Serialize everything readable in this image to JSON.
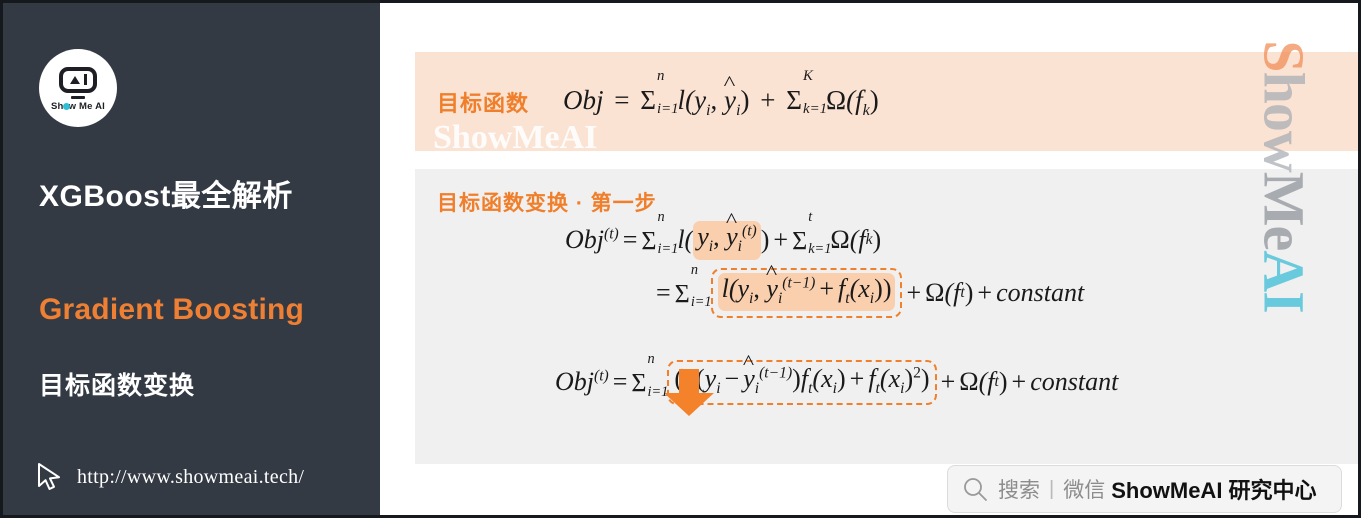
{
  "sidebar": {
    "logo": {
      "icon": "showmeai-robot-logo",
      "text_pre": "Sh",
      "text_dot": "o",
      "text_post": "w Me AI"
    },
    "title": "XGBoost最全解析",
    "subtitle_en": "Gradient Boosting",
    "subtitle_cn": "目标函数变换",
    "url": "http://www.showmeai.tech/",
    "cursor_icon": "cursor-arrow-icon",
    "background_color": "#333a44",
    "accent_color": "#ef8033"
  },
  "watermark": {
    "vertical": {
      "part_s": "S",
      "part_how": "how",
      "part_me": "Me",
      "part_ai": "AI",
      "color_s": "#f08b52",
      "color_how": "#a7adb3",
      "color_me": "#8d9298",
      "color_ai": "#37bcd6"
    },
    "inline": "ShowMeAI"
  },
  "top_band": {
    "label": "目标函数",
    "background_color": "#fbe3d4",
    "equation": {
      "lhs": "Obj",
      "eq": "=",
      "sum1": {
        "symbol": "Σ",
        "lower": "i=1",
        "upper": "n"
      },
      "loss": "l(y",
      "term_yi_sub": "i",
      "comma": ", ",
      "yhat": "y",
      "yhat_sub": "i",
      "close": ")",
      "plus": "+",
      "sum2": {
        "symbol": "Σ",
        "lower": "k=1",
        "upper": "K"
      },
      "omega": "Ω(f",
      "omega_sub": "k",
      "omega_close": ")"
    },
    "equation_text": "Obj = Σ_{i=1}^{n} l(y_i, ŷ_i) + Σ_{k=1}^{K} Ω(f_k)"
  },
  "body_panel": {
    "label": "目标函数变换 · 第一步",
    "background_color": "#f0f0f0",
    "arrow_icon": "arrow-down-icon",
    "arrow_color": "#f4822b",
    "highlight_color": "#f9cfae",
    "dash_border_color": "#f0802c",
    "equations": [
      {
        "id": "line-1",
        "text": "Obj^{(t)} = Σ_{i=1}^{n} l(y_i, ŷ_i^{(t)}) + Σ_{k=1}^{t} Ω(f_k)",
        "lhs": "Obj",
        "lhs_sup": "(t)",
        "eq": "=",
        "sum": {
          "symbol": "Σ",
          "lower": "i=1",
          "upper": "n"
        },
        "highlighted": "y_i, ŷ_i^{(t)}",
        "tail": "+ Σ_{k=1}^{t} Ω(f_k)"
      },
      {
        "id": "line-2",
        "text": "= Σ_{i=1}^{n} l(y_i, ŷ_i^{(t-1)} + f_t(x_i)) + Ω(f_t) + constant",
        "eq": "=",
        "sum": {
          "symbol": "Σ",
          "lower": "i=1",
          "upper": "n"
        },
        "boxed": "l(y_i, ŷ_i^{(t-1)} + f_t(x_i))",
        "tail": "+ Ω(f_t) + constant"
      },
      {
        "id": "line-3",
        "text": "Obj^{(t)} = Σ_{i=1}^{n} (2(y_i - ŷ_i^{(t-1)}) f_t(x_i) + f_t(x_i)^2) + Ω(f_t) + constant",
        "lhs": "Obj",
        "lhs_sup": "(t)",
        "eq": "=",
        "sum": {
          "symbol": "Σ",
          "lower": "i=1",
          "upper": "n"
        },
        "boxed": "(2(y_i - ŷ_i^{(t-1)}) f_t(x_i) + f_t(x_i)^2)",
        "tail": "+ Ω(f_t) + constant"
      }
    ]
  },
  "search_badge": {
    "icon": "search-icon",
    "placeholder": "搜索",
    "divider": "|",
    "channel": "微信",
    "brand": "ShowMeAI 研究中心"
  },
  "glyphs": {
    "sigma": "Σ",
    "omega": "Ω",
    "constant": "constant",
    "plus": "+",
    "minus": "−",
    "eq": "=",
    "l": "l",
    "f": "f",
    "x": "x",
    "y": "y",
    "n": "n",
    "K": "K",
    "t": "t",
    "k": "k",
    "i": "i",
    "i1": "i=1",
    "k1": "k=1",
    "Obj": "Obj",
    "sup_t": "(t)",
    "sup_t1": "(t−1)",
    "two": "2",
    "sq": "2",
    "lp": "(",
    "rp": ")",
    "comma": ",",
    "sub_i": "i",
    "sub_t": "t",
    "sub_k": "k"
  }
}
